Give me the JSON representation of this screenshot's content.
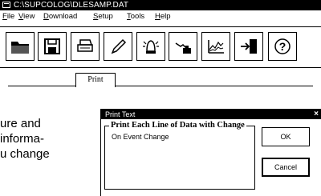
{
  "window": {
    "title": "C:\\SUPCOLOG\\DLESAMP.DAT"
  },
  "menu": [
    "File",
    "View",
    "Download",
    "Setup",
    "Tools",
    "Help"
  ],
  "toolbar": {
    "buttons": [
      {
        "name": "open-folder-icon"
      },
      {
        "name": "save-disk-icon"
      },
      {
        "name": "print-icon"
      },
      {
        "name": "pen-icon"
      },
      {
        "name": "alarm-bell-icon"
      },
      {
        "name": "calibrate-hand-icon"
      },
      {
        "name": "graph-icon"
      },
      {
        "name": "exit-door-icon"
      },
      {
        "name": "help-question-icon"
      }
    ]
  },
  "tabs": {
    "print_label": "Print"
  },
  "body": {
    "lines": [
      "ure and",
      "informa-",
      "u change"
    ]
  },
  "dialog": {
    "title": "Print Text",
    "close_label": "×",
    "group_label": "Print Each Line of Data with Change",
    "group_item": "On Event Change",
    "ok_label": "OK",
    "cancel_label": "Cancel"
  }
}
